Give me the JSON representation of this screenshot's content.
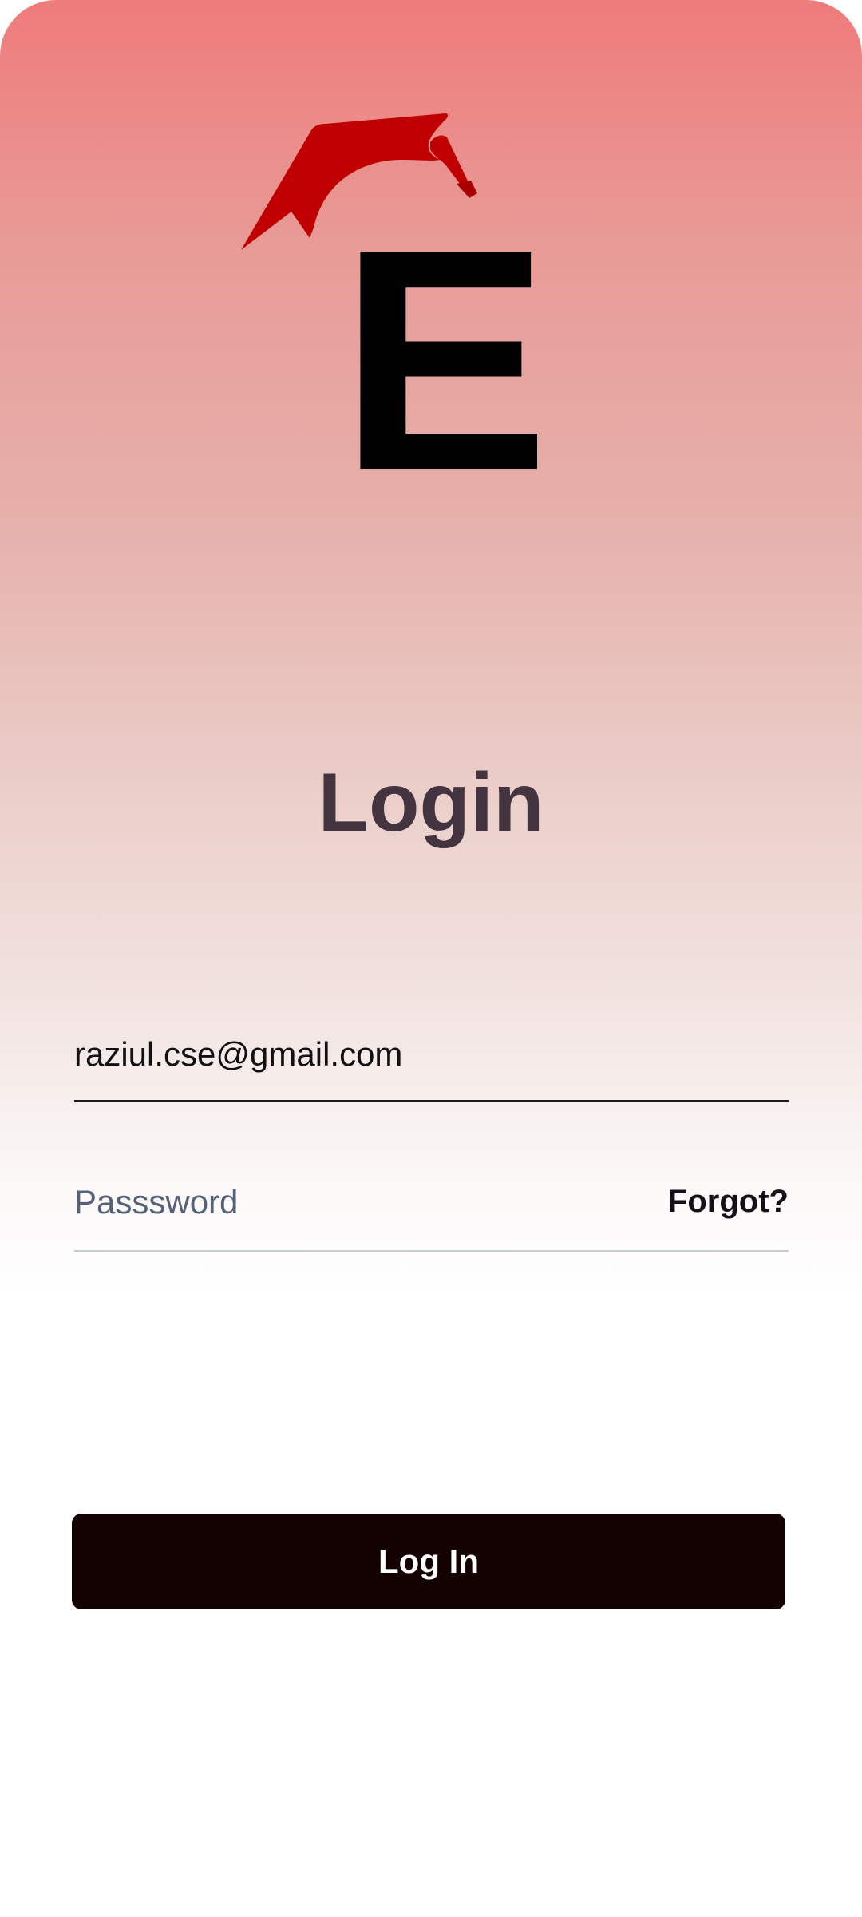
{
  "app": {
    "logo_letter": "E",
    "logo_icon": "graduation-cap-icon",
    "accent_color": "#c00000"
  },
  "login": {
    "title": "Login",
    "email": {
      "value": "raziul.cse@gmail.com"
    },
    "password": {
      "placeholder": "Passsword",
      "value": ""
    },
    "forgot_label": "Forgot?",
    "submit_label": "Log In"
  }
}
